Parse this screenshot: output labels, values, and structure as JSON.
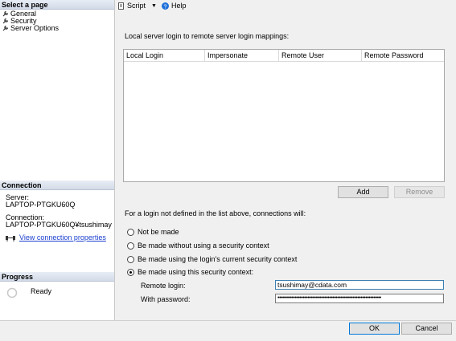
{
  "left_panel": {
    "select_page_title": "Select a page",
    "pages": [
      {
        "label": "General",
        "icon": "wrench-icon"
      },
      {
        "label": "Security",
        "icon": "wrench-icon"
      },
      {
        "label": "Server Options",
        "icon": "wrench-icon"
      }
    ],
    "connection_title": "Connection",
    "server_label": "Server:",
    "server_value": "LAPTOP-PTGKU60Q",
    "connection_label": "Connection:",
    "connection_value": "LAPTOP-PTGKU60Q¥tsushimay",
    "view_connection_link": "View connection properties",
    "progress_title": "Progress",
    "progress_status": "Ready"
  },
  "toolbar": {
    "script_label": "Script",
    "help_label": "Help"
  },
  "main": {
    "mappings_heading": "Local server login to remote server login mappings:",
    "grid_columns": [
      "Local Login",
      "Impersonate",
      "Remote User",
      "Remote Password"
    ],
    "add_button": "Add",
    "remove_button": "Remove",
    "undefined_heading": "For a login not defined in the list above, connections will:",
    "options": [
      {
        "label": "Not be made",
        "selected": false
      },
      {
        "label": "Be made without using a security context",
        "selected": false
      },
      {
        "label": "Be made using the login's current security context",
        "selected": false
      },
      {
        "label": "Be made using this security context:",
        "selected": true
      }
    ],
    "remote_login_label": "Remote login:",
    "remote_login_value": "tsushimay@cdata.com",
    "password_label": "With password:",
    "password_value": "••••••••••••••••••••••••••••••••••••••••••••••••••••••••••••••••••"
  },
  "footer": {
    "ok_button": "OK",
    "cancel_button": "Cancel"
  }
}
